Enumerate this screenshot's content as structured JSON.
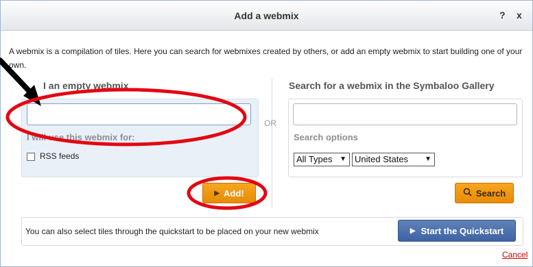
{
  "dialog": {
    "title": "Add a webmix",
    "help": "?",
    "close": "x",
    "intro": "A webmix is a compilation of tiles. Here you can search for webmixes created by others, or add an empty webmix to start building one of your own."
  },
  "left": {
    "title": "I an empty webmix",
    "input_value": "",
    "use_label": "I will use this webmix for:",
    "checkbox_label": "RSS feeds",
    "add_label": "Add!"
  },
  "or_label": "OR",
  "right": {
    "title": "Search for a webmix in the Symbaloo Gallery",
    "input_value": "",
    "options_label": "Search options",
    "type_select": "All Types",
    "country_select": "United States",
    "search_label": "Search"
  },
  "quickstart": {
    "text": "You can also select tiles through the quickstart to be placed on your new webmix",
    "button_label": "Start the Quickstart"
  },
  "cancel_label": "Cancel",
  "colors": {
    "accent_orange": "#f39a15",
    "accent_blue": "#4a6eab",
    "annotation_red": "#e30613"
  },
  "icons": [
    "play-icon",
    "search-icon",
    "arrow-annotation"
  ]
}
